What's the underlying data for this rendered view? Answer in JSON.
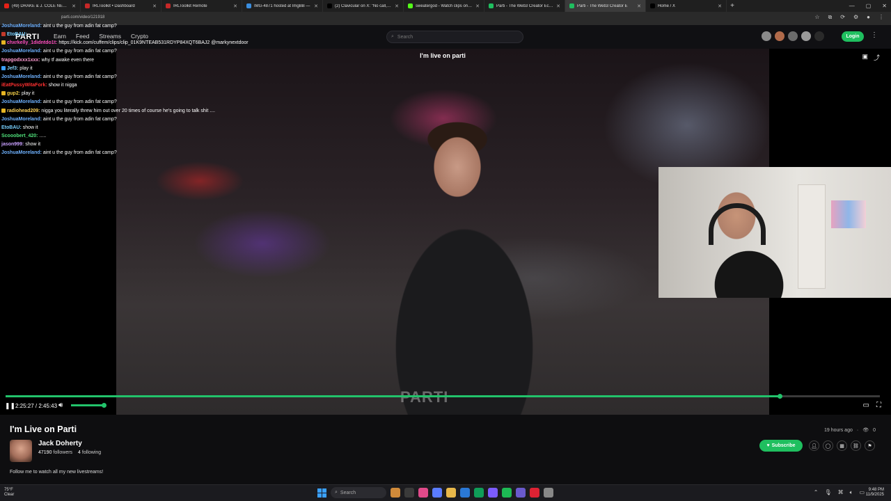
{
  "browser": {
    "tabs": [
      {
        "label": "(49) DRAKE & J. COLE NEED TO",
        "color": "#e62117",
        "active": false
      },
      {
        "label": "IRLToolkit • Dashboard",
        "color": "#c62828",
        "active": false
      },
      {
        "label": "IRLToolkit Remote",
        "color": "#c62828",
        "active": false
      },
      {
        "label": "IMG-4871 hosted at ImgBB —",
        "color": "#3a8dde",
        "active": false
      },
      {
        "label": "(2) Clavicular on X: \"No call, id b",
        "color": "#000000",
        "active": false
      },
      {
        "label": "sweatergod - Watch clips on Ki",
        "color": "#53fc18",
        "active": false
      },
      {
        "label": "Parti - The Web3 Creator Econ",
        "color": "#1fbf5f",
        "active": false
      },
      {
        "label": "Parti - The Web3 Creator E",
        "color": "#1fbf5f",
        "active": true
      },
      {
        "label": "Home / X",
        "color": "#000000",
        "active": false
      }
    ],
    "url": "parti.com/video/121918",
    "win_min": "—",
    "win_max": "▢",
    "win_close": "✕",
    "new_tab": "+"
  },
  "nav": {
    "logo": "PARTI",
    "links": [
      "Earn",
      "Feed",
      "Streams",
      "Crypto"
    ],
    "search_placeholder": "Search",
    "login": "Login",
    "avatar_colors": [
      "#8a8a8a",
      "#b06a4a",
      "#6b6b6b",
      "#9a9a9a",
      "#2a2a2a"
    ]
  },
  "video": {
    "overlay_title": "I'm live on parti",
    "watermark": "PARTI",
    "time_current": "2:25:27",
    "time_total": "2:45:43",
    "progress_fraction": 0.885,
    "volume_fraction": 1.0
  },
  "chat": [
    {
      "user": "JoshuaMoreland:",
      "color": "#6fb2ff",
      "text": "aint u the guy from adin fat camp?",
      "badge": ""
    },
    {
      "user": "EtoBAU:",
      "color": "#79d1ff",
      "text": "",
      "badge": "#c0392b"
    },
    {
      "user": "chxrkelly_1didntdo1t:",
      "color": "#ff4fbf",
      "text": "https://kick.com/cuffem/clips/clip_01K9NTEAB531RDYP84XQT6BAJ2 @markynextdoor",
      "badge": "#e6b422"
    },
    {
      "user": "JoshuaMoreland:",
      "color": "#6fb2ff",
      "text": "aint u the guy from adin fat camp?",
      "badge": ""
    },
    {
      "user": "trapgodxxx1xxx:",
      "color": "#ff9bd2",
      "text": "why tf awake even there",
      "badge": ""
    },
    {
      "user": "Jef3:",
      "color": "#8ad7ff",
      "text": "play it",
      "badge": "#3aa0ff"
    },
    {
      "user": "JoshuaMoreland:",
      "color": "#6fb2ff",
      "text": "aint u the guy from adin fat camp?",
      "badge": ""
    },
    {
      "user": "iEatPussyWitaFork:",
      "color": "#ff3030",
      "text": "show it nigga",
      "badge": ""
    },
    {
      "user": "gup2:",
      "color": "#f7d24a",
      "text": "play it",
      "badge": "#e6b422"
    },
    {
      "user": "JoshuaMoreland:",
      "color": "#6fb2ff",
      "text": "aint u the guy from adin fat camp?",
      "badge": ""
    },
    {
      "user": "radiohead209:",
      "color": "#ffd35a",
      "text": "nigga you literally threw him out over 20 times of course he's going to talk shit ....",
      "badge": "#e6b422"
    },
    {
      "user": "JoshuaMoreland:",
      "color": "#6fb2ff",
      "text": "aint u the guy from adin fat camp?",
      "badge": ""
    },
    {
      "user": "EtoBAU:",
      "color": "#79d1ff",
      "text": "show it",
      "badge": ""
    },
    {
      "user": "Scooobert_420:",
      "color": "#4fe07a",
      "text": ".....",
      "badge": ""
    },
    {
      "user": "jason999:",
      "color": "#c9a0ff",
      "text": "show it",
      "badge": ""
    },
    {
      "user": "JoshuaMoreland:",
      "color": "#6fb2ff",
      "text": "aint u the guy from adin fat camp?",
      "badge": ""
    }
  ],
  "info": {
    "title": "I'm Live on Parti",
    "posted": "19 hours ago",
    "views": "0",
    "streamer_name": "Jack Doherty",
    "followers_count": "47190",
    "followers_label": "followers",
    "following_count": "4",
    "following_label": "following",
    "description": "Follow me to watch all my new livestreams!",
    "subscribe_label": "Subscribe"
  },
  "taskbar": {
    "temp": "75°F",
    "condition": "Clear",
    "search": "Search",
    "time": "9:48 PM",
    "date": "11/9/2025",
    "app_colors": [
      "#d08a3a",
      "#3a3a3a",
      "#e04a8a",
      "#5a7cff",
      "#e8b84a",
      "#2a78d6",
      "#0f9d58",
      "#7c5cff",
      "#1db954",
      "#6a5acd",
      "#d23",
      "#888"
    ]
  },
  "colors": {
    "accent": "#1fbf5f",
    "progress": "#22c36b",
    "background": "#0e0e10"
  }
}
